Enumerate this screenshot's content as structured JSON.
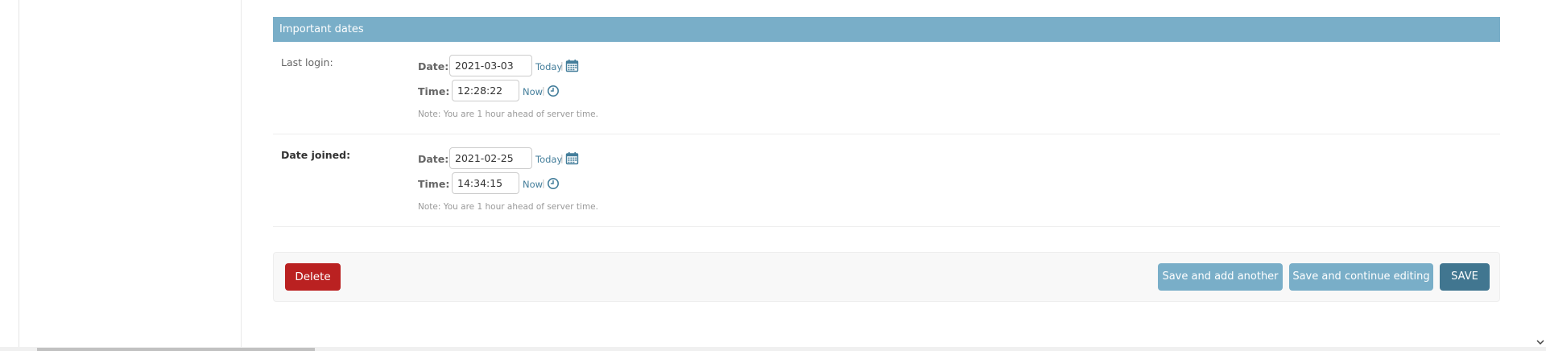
{
  "fieldset": {
    "title": "Important dates"
  },
  "last_login": {
    "label": "Last login:",
    "date_label": "Date:",
    "date_value": "2021-03-03",
    "today_link": "Today",
    "time_label": "Time:",
    "time_value": "12:28:22",
    "now_link": "Now",
    "note": "Note: You are 1 hour ahead of server time."
  },
  "date_joined": {
    "label": "Date joined:",
    "date_label": "Date:",
    "date_value": "2021-02-25",
    "today_link": "Today",
    "time_label": "Time:",
    "time_value": "14:34:15",
    "now_link": "Now",
    "note": "Note: You are 1 hour ahead of server time."
  },
  "submit_row": {
    "delete_label": "Delete",
    "save_add_another_label": "Save and add another",
    "save_continue_label": "Save and continue editing",
    "save_label": "SAVE"
  },
  "separator": "|",
  "icons": {
    "calendar": "calendar-icon",
    "clock": "clock-icon",
    "scroll_down": "chevron-down-icon"
  },
  "colors": {
    "header": "#79aec8",
    "link": "#447e9b",
    "delete": "#ba2121",
    "save": "#417690",
    "secondary_button": "#79aec8"
  }
}
